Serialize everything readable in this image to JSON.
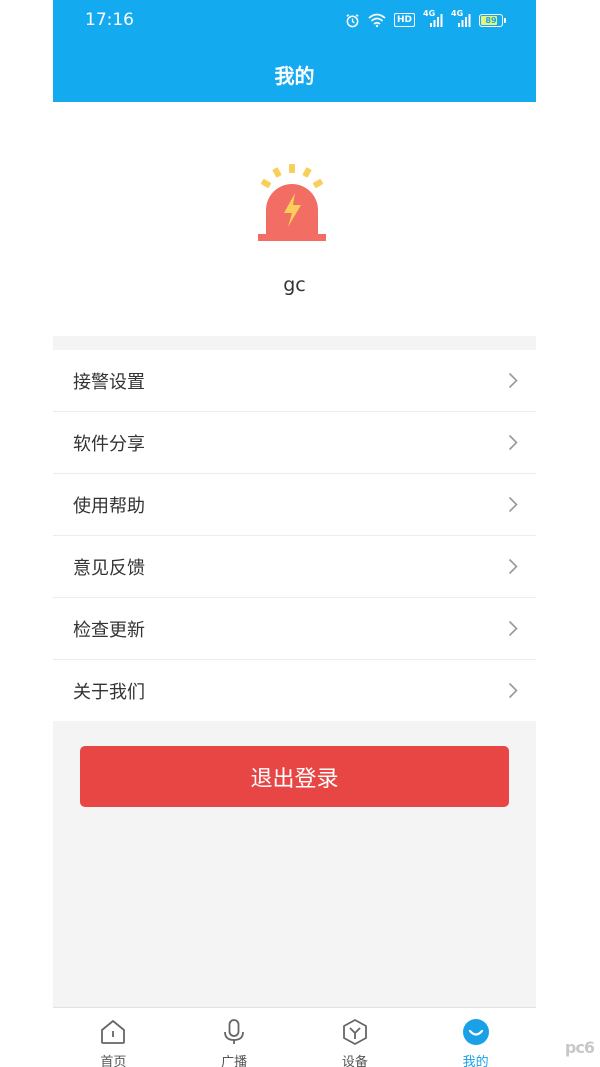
{
  "status_bar": {
    "time": "17:16",
    "hd_label": "HD",
    "signal1_label": "4G",
    "signal2_label": "4G",
    "battery_level": "89"
  },
  "header": {
    "title": "我的"
  },
  "profile": {
    "username": "gc",
    "avatar_icon": "alarm-siren-icon"
  },
  "menu": {
    "items": [
      {
        "label": "接警设置"
      },
      {
        "label": "软件分享"
      },
      {
        "label": "使用帮助"
      },
      {
        "label": "意见反馈"
      },
      {
        "label": "检查更新"
      },
      {
        "label": "关于我们"
      }
    ]
  },
  "logout": {
    "label": "退出登录"
  },
  "tabbar": {
    "tabs": [
      {
        "label": "首页",
        "icon": "home-icon"
      },
      {
        "label": "广播",
        "icon": "microphone-icon"
      },
      {
        "label": "设备",
        "icon": "device-cube-icon"
      },
      {
        "label": "我的",
        "icon": "profile-smile-icon",
        "active": true
      }
    ]
  },
  "watermark": {
    "text": "pc6"
  },
  "colors": {
    "header_bg": "#14aaf0",
    "logout_bg": "#e84545",
    "active_tab": "#1aa0e6",
    "siren_red": "#f26d63",
    "siren_rays": "#f8cf5a"
  }
}
